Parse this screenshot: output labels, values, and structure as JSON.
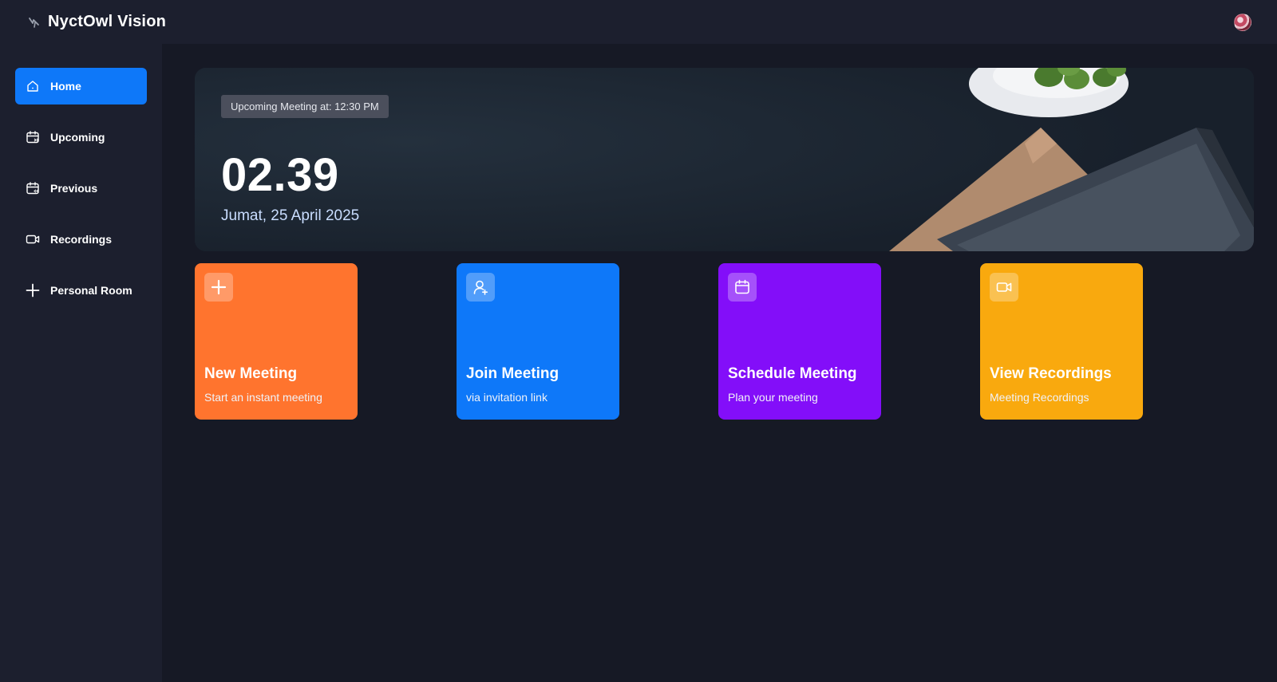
{
  "app": {
    "name": "NyctOwl Vision",
    "logo_icon": "brand-logo-icon"
  },
  "header": {
    "avatar_icon": "user-avatar"
  },
  "sidebar": {
    "items": [
      {
        "label": "Home",
        "icon": "home-icon",
        "active": true
      },
      {
        "label": "Upcoming",
        "icon": "calendar-upcoming-icon",
        "active": false
      },
      {
        "label": "Previous",
        "icon": "calendar-previous-icon",
        "active": false
      },
      {
        "label": "Recordings",
        "icon": "video-icon",
        "active": false
      },
      {
        "label": "Personal Room",
        "icon": "plus-icon",
        "active": false
      }
    ]
  },
  "hero": {
    "badge": "Upcoming Meeting at: 12:30 PM",
    "time": "02.39",
    "date": "Jumat, 25 April 2025"
  },
  "cards": [
    {
      "title": "New Meeting",
      "subtitle": "Start an instant meeting",
      "icon": "plus-icon",
      "color": "#ff742e"
    },
    {
      "title": "Join Meeting",
      "subtitle": "via invitation link",
      "icon": "add-user-icon",
      "color": "#0e78f9"
    },
    {
      "title": "Schedule Meeting",
      "subtitle": "Plan your meeting",
      "icon": "calendar-icon",
      "color": "#830ef9"
    },
    {
      "title": "View Recordings",
      "subtitle": "Meeting Recordings",
      "icon": "video-icon",
      "color": "#f9a90e"
    }
  ],
  "colors": {
    "accent": "#0e78f9",
    "background": "#161925",
    "panel": "#1c1f2e"
  }
}
